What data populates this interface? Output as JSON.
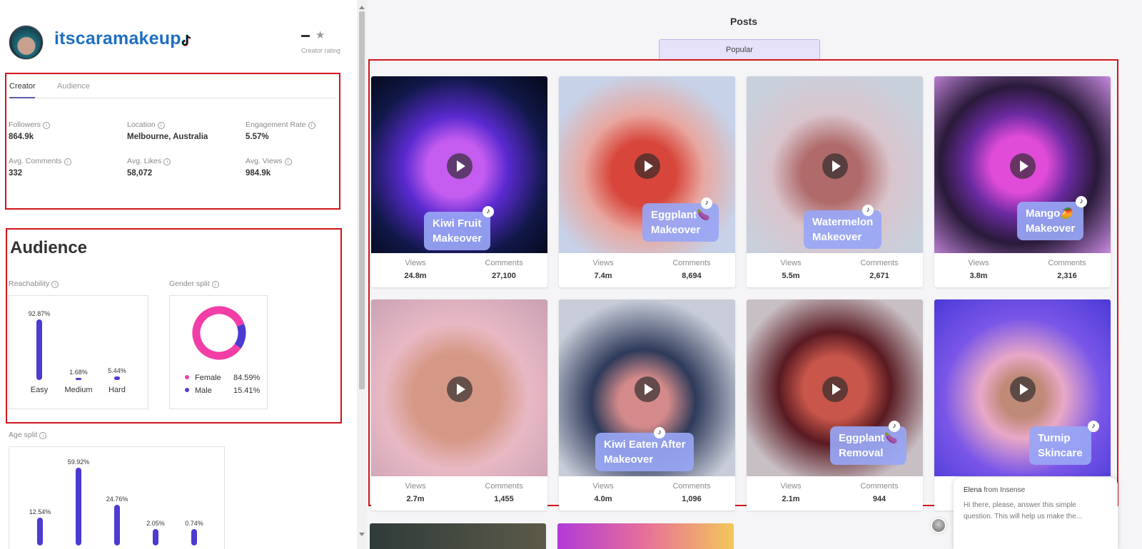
{
  "profile": {
    "username": "itscaramakeup",
    "rating_value": "–",
    "rating_label": "Creator rating"
  },
  "tabs": [
    {
      "label": "Creator"
    },
    {
      "label": "Audience"
    }
  ],
  "stats": [
    {
      "label": "Followers",
      "value": "864.9k"
    },
    {
      "label": "Location",
      "value": "Melbourne, Australia"
    },
    {
      "label": "Engagement Rate",
      "value": "5.57%"
    },
    {
      "label": "Avg. Comments",
      "value": "332"
    },
    {
      "label": "Avg. Likes",
      "value": "58,072"
    },
    {
      "label": "Avg. Views",
      "value": "984.9k"
    }
  ],
  "audience": {
    "title": "Audience",
    "reachability_label": "Reachability",
    "gender_label": "Gender split",
    "age_label": "Age split",
    "info_glyph": "i"
  },
  "chart_data": [
    {
      "type": "bar",
      "categories": [
        "Easy",
        "Medium",
        "Hard"
      ],
      "values": [
        92.87,
        1.68,
        5.44
      ],
      "value_labels": [
        "92.87%",
        "1.68%",
        "5.44%"
      ],
      "color": "#4b3bd0"
    },
    {
      "type": "pie",
      "categories": [
        "Female",
        "Male"
      ],
      "values": [
        84.59,
        15.41
      ],
      "value_labels": [
        "84.59%",
        "15.41%"
      ],
      "colors": [
        "#f23ea6",
        "#4b3bd0"
      ]
    },
    {
      "type": "bar",
      "categories": [],
      "values": [
        12.54,
        59.92,
        24.76,
        2.05,
        0.74
      ],
      "value_labels": [
        "12.54%",
        "59.92%",
        "24.76%",
        "2.05%",
        "0.74%"
      ],
      "color": "#4b3bd0"
    }
  ],
  "posts_section": {
    "title": "Posts",
    "filter_tab": "Popular",
    "views_label": "Views",
    "comments_label": "Comments"
  },
  "posts": [
    {
      "caption_1": "Kiwi Fruit",
      "caption_2": "Makeover",
      "views": "24.8m",
      "comments": "27,100"
    },
    {
      "caption_1": "Eggplant🍆",
      "caption_2": "Makeover",
      "views": "7.4m",
      "comments": "8,694"
    },
    {
      "caption_1": "Watermelon",
      "caption_2": "Makeover",
      "views": "5.5m",
      "comments": "2,671"
    },
    {
      "caption_1": "Mango🥭",
      "caption_2": "Makeover",
      "views": "3.8m",
      "comments": "2,316"
    },
    {
      "caption_1": "",
      "caption_2": "",
      "views": "2.7m",
      "comments": "1,455"
    },
    {
      "caption_1": "Kiwi Eaten After",
      "caption_2": "Makeover",
      "views": "4.0m",
      "comments": "1,096"
    },
    {
      "caption_1": "Eggplant🍆",
      "caption_2": "Removal",
      "views": "2.1m",
      "comments": "944"
    },
    {
      "caption_1": "Turnip",
      "caption_2": "Skincare",
      "views": "",
      "comments": ""
    }
  ],
  "chat": {
    "agent": "Elena",
    "source": "from Insense",
    "message_1": "Hi there, please, answer this simple",
    "message_2": "question. This will help us make the..."
  }
}
